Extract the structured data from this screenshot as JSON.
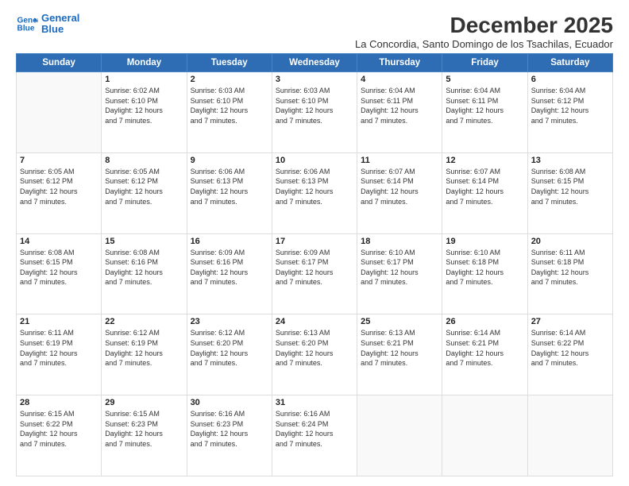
{
  "logo": {
    "line1": "General",
    "line2": "Blue"
  },
  "title": "December 2025",
  "subtitle": "La Concordia, Santo Domingo de los Tsachilas, Ecuador",
  "days_header": [
    "Sunday",
    "Monday",
    "Tuesday",
    "Wednesday",
    "Thursday",
    "Friday",
    "Saturday"
  ],
  "weeks": [
    [
      {
        "day": "",
        "info": ""
      },
      {
        "day": "1",
        "info": "Sunrise: 6:02 AM\nSunset: 6:10 PM\nDaylight: 12 hours\nand 7 minutes."
      },
      {
        "day": "2",
        "info": "Sunrise: 6:03 AM\nSunset: 6:10 PM\nDaylight: 12 hours\nand 7 minutes."
      },
      {
        "day": "3",
        "info": "Sunrise: 6:03 AM\nSunset: 6:10 PM\nDaylight: 12 hours\nand 7 minutes."
      },
      {
        "day": "4",
        "info": "Sunrise: 6:04 AM\nSunset: 6:11 PM\nDaylight: 12 hours\nand 7 minutes."
      },
      {
        "day": "5",
        "info": "Sunrise: 6:04 AM\nSunset: 6:11 PM\nDaylight: 12 hours\nand 7 minutes."
      },
      {
        "day": "6",
        "info": "Sunrise: 6:04 AM\nSunset: 6:12 PM\nDaylight: 12 hours\nand 7 minutes."
      }
    ],
    [
      {
        "day": "7",
        "info": "Sunrise: 6:05 AM\nSunset: 6:12 PM\nDaylight: 12 hours\nand 7 minutes."
      },
      {
        "day": "8",
        "info": "Sunrise: 6:05 AM\nSunset: 6:12 PM\nDaylight: 12 hours\nand 7 minutes."
      },
      {
        "day": "9",
        "info": "Sunrise: 6:06 AM\nSunset: 6:13 PM\nDaylight: 12 hours\nand 7 minutes."
      },
      {
        "day": "10",
        "info": "Sunrise: 6:06 AM\nSunset: 6:13 PM\nDaylight: 12 hours\nand 7 minutes."
      },
      {
        "day": "11",
        "info": "Sunrise: 6:07 AM\nSunset: 6:14 PM\nDaylight: 12 hours\nand 7 minutes."
      },
      {
        "day": "12",
        "info": "Sunrise: 6:07 AM\nSunset: 6:14 PM\nDaylight: 12 hours\nand 7 minutes."
      },
      {
        "day": "13",
        "info": "Sunrise: 6:08 AM\nSunset: 6:15 PM\nDaylight: 12 hours\nand 7 minutes."
      }
    ],
    [
      {
        "day": "14",
        "info": "Sunrise: 6:08 AM\nSunset: 6:15 PM\nDaylight: 12 hours\nand 7 minutes."
      },
      {
        "day": "15",
        "info": "Sunrise: 6:08 AM\nSunset: 6:16 PM\nDaylight: 12 hours\nand 7 minutes."
      },
      {
        "day": "16",
        "info": "Sunrise: 6:09 AM\nSunset: 6:16 PM\nDaylight: 12 hours\nand 7 minutes."
      },
      {
        "day": "17",
        "info": "Sunrise: 6:09 AM\nSunset: 6:17 PM\nDaylight: 12 hours\nand 7 minutes."
      },
      {
        "day": "18",
        "info": "Sunrise: 6:10 AM\nSunset: 6:17 PM\nDaylight: 12 hours\nand 7 minutes."
      },
      {
        "day": "19",
        "info": "Sunrise: 6:10 AM\nSunset: 6:18 PM\nDaylight: 12 hours\nand 7 minutes."
      },
      {
        "day": "20",
        "info": "Sunrise: 6:11 AM\nSunset: 6:18 PM\nDaylight: 12 hours\nand 7 minutes."
      }
    ],
    [
      {
        "day": "21",
        "info": "Sunrise: 6:11 AM\nSunset: 6:19 PM\nDaylight: 12 hours\nand 7 minutes."
      },
      {
        "day": "22",
        "info": "Sunrise: 6:12 AM\nSunset: 6:19 PM\nDaylight: 12 hours\nand 7 minutes."
      },
      {
        "day": "23",
        "info": "Sunrise: 6:12 AM\nSunset: 6:20 PM\nDaylight: 12 hours\nand 7 minutes."
      },
      {
        "day": "24",
        "info": "Sunrise: 6:13 AM\nSunset: 6:20 PM\nDaylight: 12 hours\nand 7 minutes."
      },
      {
        "day": "25",
        "info": "Sunrise: 6:13 AM\nSunset: 6:21 PM\nDaylight: 12 hours\nand 7 minutes."
      },
      {
        "day": "26",
        "info": "Sunrise: 6:14 AM\nSunset: 6:21 PM\nDaylight: 12 hours\nand 7 minutes."
      },
      {
        "day": "27",
        "info": "Sunrise: 6:14 AM\nSunset: 6:22 PM\nDaylight: 12 hours\nand 7 minutes."
      }
    ],
    [
      {
        "day": "28",
        "info": "Sunrise: 6:15 AM\nSunset: 6:22 PM\nDaylight: 12 hours\nand 7 minutes."
      },
      {
        "day": "29",
        "info": "Sunrise: 6:15 AM\nSunset: 6:23 PM\nDaylight: 12 hours\nand 7 minutes."
      },
      {
        "day": "30",
        "info": "Sunrise: 6:16 AM\nSunset: 6:23 PM\nDaylight: 12 hours\nand 7 minutes."
      },
      {
        "day": "31",
        "info": "Sunrise: 6:16 AM\nSunset: 6:24 PM\nDaylight: 12 hours\nand 7 minutes."
      },
      {
        "day": "",
        "info": ""
      },
      {
        "day": "",
        "info": ""
      },
      {
        "day": "",
        "info": ""
      }
    ]
  ]
}
